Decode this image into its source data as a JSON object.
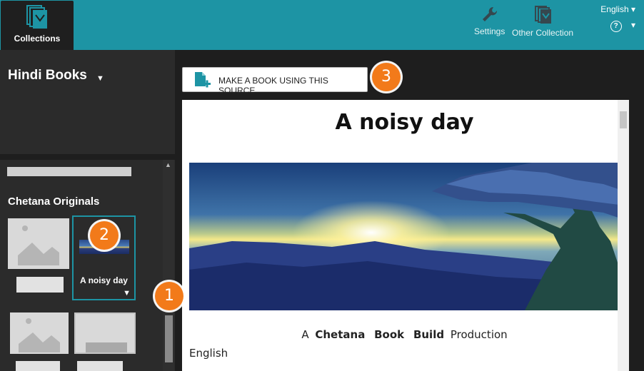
{
  "topbar": {
    "collections_tab": "Collections",
    "settings": "Settings",
    "other_collection": "Other Collection",
    "language": "English",
    "language_caret": "▾",
    "help_icon": "?",
    "help_caret": "▾"
  },
  "collection": {
    "title": "Hindi Books",
    "caret": "▼"
  },
  "list": {
    "section_title": "Chetana Originals",
    "selected_book": {
      "title": "A noisy day",
      "caret": "▼"
    },
    "scroll_up": "▲"
  },
  "badges": {
    "one": "1",
    "two": "2",
    "three": "3"
  },
  "main": {
    "make_book_button": "MAKE A BOOK USING THIS SOURCE"
  },
  "preview": {
    "title": "A noisy day",
    "credit_a": "A",
    "credit_b1": "Chetana",
    "credit_b2": "Book",
    "credit_b3": "Build",
    "credit_end": "Production",
    "language": "English"
  },
  "colors": {
    "accent": "#1d94a4",
    "badge": "#f27a1a"
  }
}
